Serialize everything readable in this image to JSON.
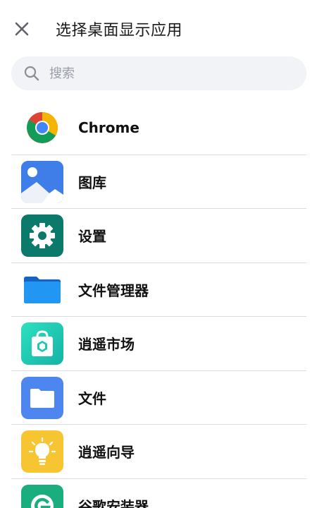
{
  "header": {
    "title": "选择桌面显示应用"
  },
  "search": {
    "placeholder": "搜索"
  },
  "apps": [
    {
      "label": "Chrome",
      "icon": "chrome-icon"
    },
    {
      "label": "图库",
      "icon": "gallery-icon"
    },
    {
      "label": "设置",
      "icon": "settings-gear-icon"
    },
    {
      "label": "文件管理器",
      "icon": "file-manager-folder-icon"
    },
    {
      "label": "逍遥市场",
      "icon": "app-market-bag-icon"
    },
    {
      "label": "文件",
      "icon": "files-folder-icon"
    },
    {
      "label": "逍遥向导",
      "icon": "guide-lightbulb-icon"
    },
    {
      "label": "谷歌安装器",
      "icon": "google-installer-icon"
    }
  ],
  "colors": {
    "search_bg": "#f1f3f6",
    "divider": "#dadce0",
    "gallery_blue": "#3f7de8",
    "settings_teal": "#0b7a6a",
    "market_teal": "#1fc8b0",
    "files_blue": "#4c86ee",
    "guide_yellow": "#f7c531",
    "installer_green": "#1aae7e"
  }
}
